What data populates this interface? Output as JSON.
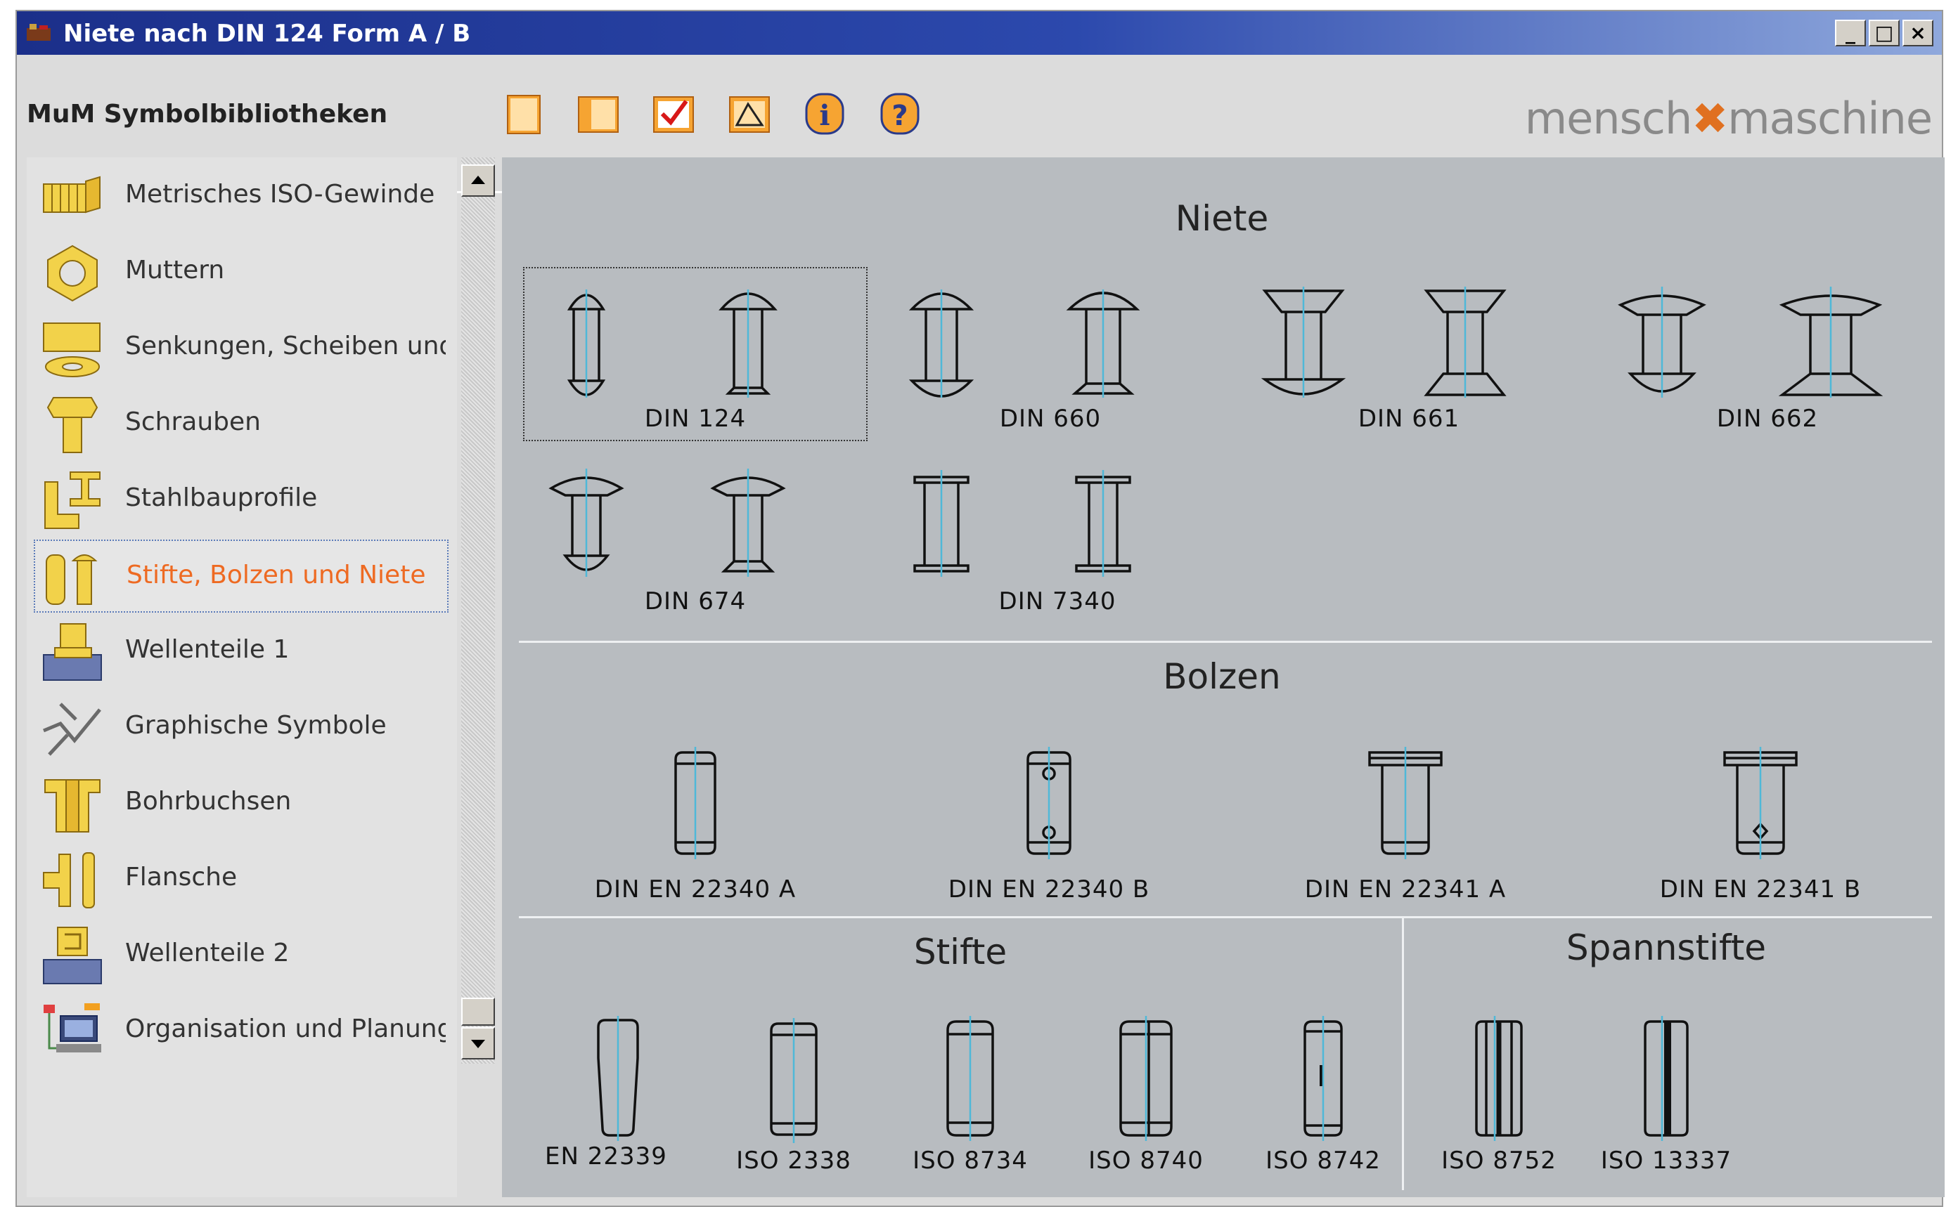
{
  "window": {
    "title": "Niete nach DIN 124 Form A / B",
    "controls": {
      "minimize": "_",
      "maximize": "□",
      "close": "×"
    }
  },
  "header": {
    "library_title": "MuM Symbolbibliotheken",
    "brand_left": "mensch",
    "brand_right": "maschine",
    "toolbar": [
      "new-sheet-icon",
      "open-sheet-icon",
      "check-icon",
      "insert-symbol-icon",
      "info-icon",
      "help-icon"
    ]
  },
  "sidebar": {
    "selected_index": 5,
    "items": [
      {
        "label": "Metrisches ISO-Gewinde",
        "icon": "thread-icon"
      },
      {
        "label": "Muttern",
        "icon": "nut-icon"
      },
      {
        "label": "Senkungen, Scheiben und Du",
        "icon": "washer-icon"
      },
      {
        "label": "Schrauben",
        "icon": "screw-icon"
      },
      {
        "label": "Stahlbauprofile",
        "icon": "steel-profile-icon"
      },
      {
        "label": "Stifte, Bolzen und Niete",
        "icon": "pin-bolt-rivet-icon"
      },
      {
        "label": "Wellenteile 1",
        "icon": "shaft-part-icon"
      },
      {
        "label": "Graphische Symbole",
        "icon": "graphic-symbol-icon"
      },
      {
        "label": "Bohrbuchsen",
        "icon": "drill-bushing-icon"
      },
      {
        "label": "Flansche",
        "icon": "flange-icon"
      },
      {
        "label": "Wellenteile 2",
        "icon": "shaft-part-2-icon"
      },
      {
        "label": "Organisation und Planung",
        "icon": "organisation-icon"
      }
    ]
  },
  "main": {
    "sections": {
      "niete": {
        "title": "Niete",
        "items": [
          "DIN 124",
          "DIN 660",
          "DIN 661",
          "DIN 662",
          "DIN 674",
          "DIN 7340"
        ],
        "selected": "DIN 124"
      },
      "bolzen": {
        "title": "Bolzen",
        "items": [
          "DIN EN 22340 A",
          "DIN EN 22340 B",
          "DIN EN 22341 A",
          "DIN EN 22341 B"
        ]
      },
      "stifte": {
        "title": "Stifte",
        "items": [
          "EN 22339",
          "ISO 2338",
          "ISO 8734",
          "ISO 8740",
          "ISO 8742"
        ]
      },
      "spannstifte": {
        "title": "Spannstifte",
        "items": [
          "ISO 8752",
          "ISO 13337"
        ]
      }
    }
  },
  "colors": {
    "title_bar": "#1b2f8a",
    "selected_label": "#ee6a22",
    "symbol_panel": "#b8bcc0",
    "centerline": "#4fb8d8"
  }
}
